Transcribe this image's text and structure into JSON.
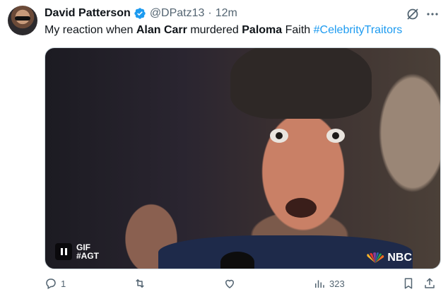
{
  "author": {
    "name": "David Patterson",
    "handle": "@DPatz13",
    "separator": "·",
    "time": "12m"
  },
  "tweet": {
    "text_prefix": "My reaction when ",
    "bold1": "Alan Carr",
    "text_middle": " murdered ",
    "bold2": "Paloma",
    "text_after": " Faith ",
    "hashtag": "#CelebrityTraitors"
  },
  "media": {
    "gif_label": "GIF",
    "gif_tag": "#AGT",
    "network_logo_text": "NBC"
  },
  "actions": {
    "reply_count": "1",
    "views_count": "323"
  },
  "icons": [
    "verified-badge-icon",
    "grok-icon",
    "more-icon",
    "reply-icon",
    "retweet-icon",
    "like-icon",
    "views-icon",
    "bookmark-icon",
    "share-icon",
    "pause-icon",
    "nbc-peacock-icon"
  ],
  "colors": {
    "accent": "#1d9bf0",
    "text_secondary": "#536471",
    "text_primary": "#0f1419"
  }
}
